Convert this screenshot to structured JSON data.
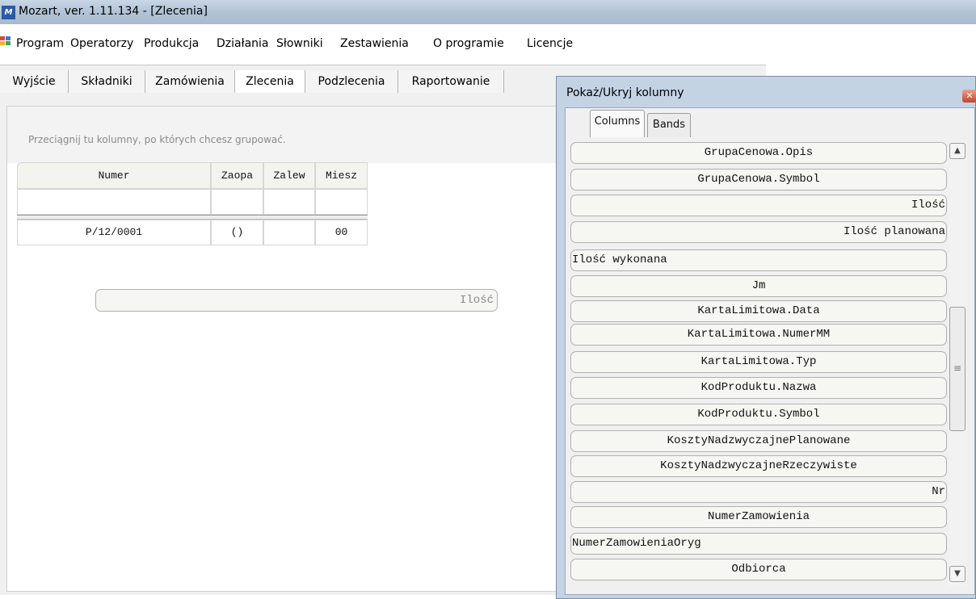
{
  "window": {
    "title": "Mozart, ver. 1.11.134 - [Zlecenia]",
    "icon": "app-logo-icon"
  },
  "menu": [
    {
      "label": "Program"
    },
    {
      "label": "Operatorzy"
    },
    {
      "label": "Produkcja"
    },
    {
      "label": "Działania"
    },
    {
      "label": "Słowniki"
    },
    {
      "label": "Zestawienia"
    },
    {
      "label": "O programie"
    },
    {
      "label": "Licencje"
    }
  ],
  "tabs": [
    {
      "label": "Wyjście"
    },
    {
      "label": "Składniki"
    },
    {
      "label": "Zamówienia"
    },
    {
      "label": "Zlecenia"
    },
    {
      "label": "Podzlecenia"
    },
    {
      "label": "Raportowanie"
    }
  ],
  "grid": {
    "group_hint": "Przeciągnij tu kolumny, po których chcesz grupować.",
    "columns": [
      "Numer",
      "Zaopa",
      "Zalew",
      "Miesz"
    ],
    "row": [
      "P/12/0001",
      "()",
      "",
      "00"
    ],
    "dragged_column": "Ilość"
  },
  "dialog": {
    "title": "Pokaż/Ukryj kolumny",
    "tabs": [
      "Columns",
      "Bands"
    ],
    "columns": [
      {
        "label": "GrupaCenowa.Opis",
        "align": "center"
      },
      {
        "label": "GrupaCenowa.Symbol",
        "align": "center"
      },
      {
        "label": "Ilość",
        "align": "right"
      },
      {
        "label": "Ilość planowana",
        "align": "right"
      },
      {
        "label": "Ilość wykonana",
        "align": "left"
      },
      {
        "label": "Jm",
        "align": "center"
      },
      {
        "label": "KartaLimitowa.Data",
        "align": "center"
      },
      {
        "label": "KartaLimitowa.NumerMM",
        "align": "center"
      },
      {
        "label": "KartaLimitowa.Typ",
        "align": "center"
      },
      {
        "label": "KodProduktu.Nazwa",
        "align": "center"
      },
      {
        "label": "KodProduktu.Symbol",
        "align": "center"
      },
      {
        "label": "KosztyNadzwyczajnePlanowane",
        "align": "center"
      },
      {
        "label": "KosztyNadzwyczajneRzeczywiste",
        "align": "center"
      },
      {
        "label": "Nr",
        "align": "right"
      },
      {
        "label": "NumerZamowienia",
        "align": "center"
      },
      {
        "label": "NumerZamowieniaOryg",
        "align": "left"
      },
      {
        "label": "Odbiorca",
        "align": "center"
      }
    ]
  }
}
